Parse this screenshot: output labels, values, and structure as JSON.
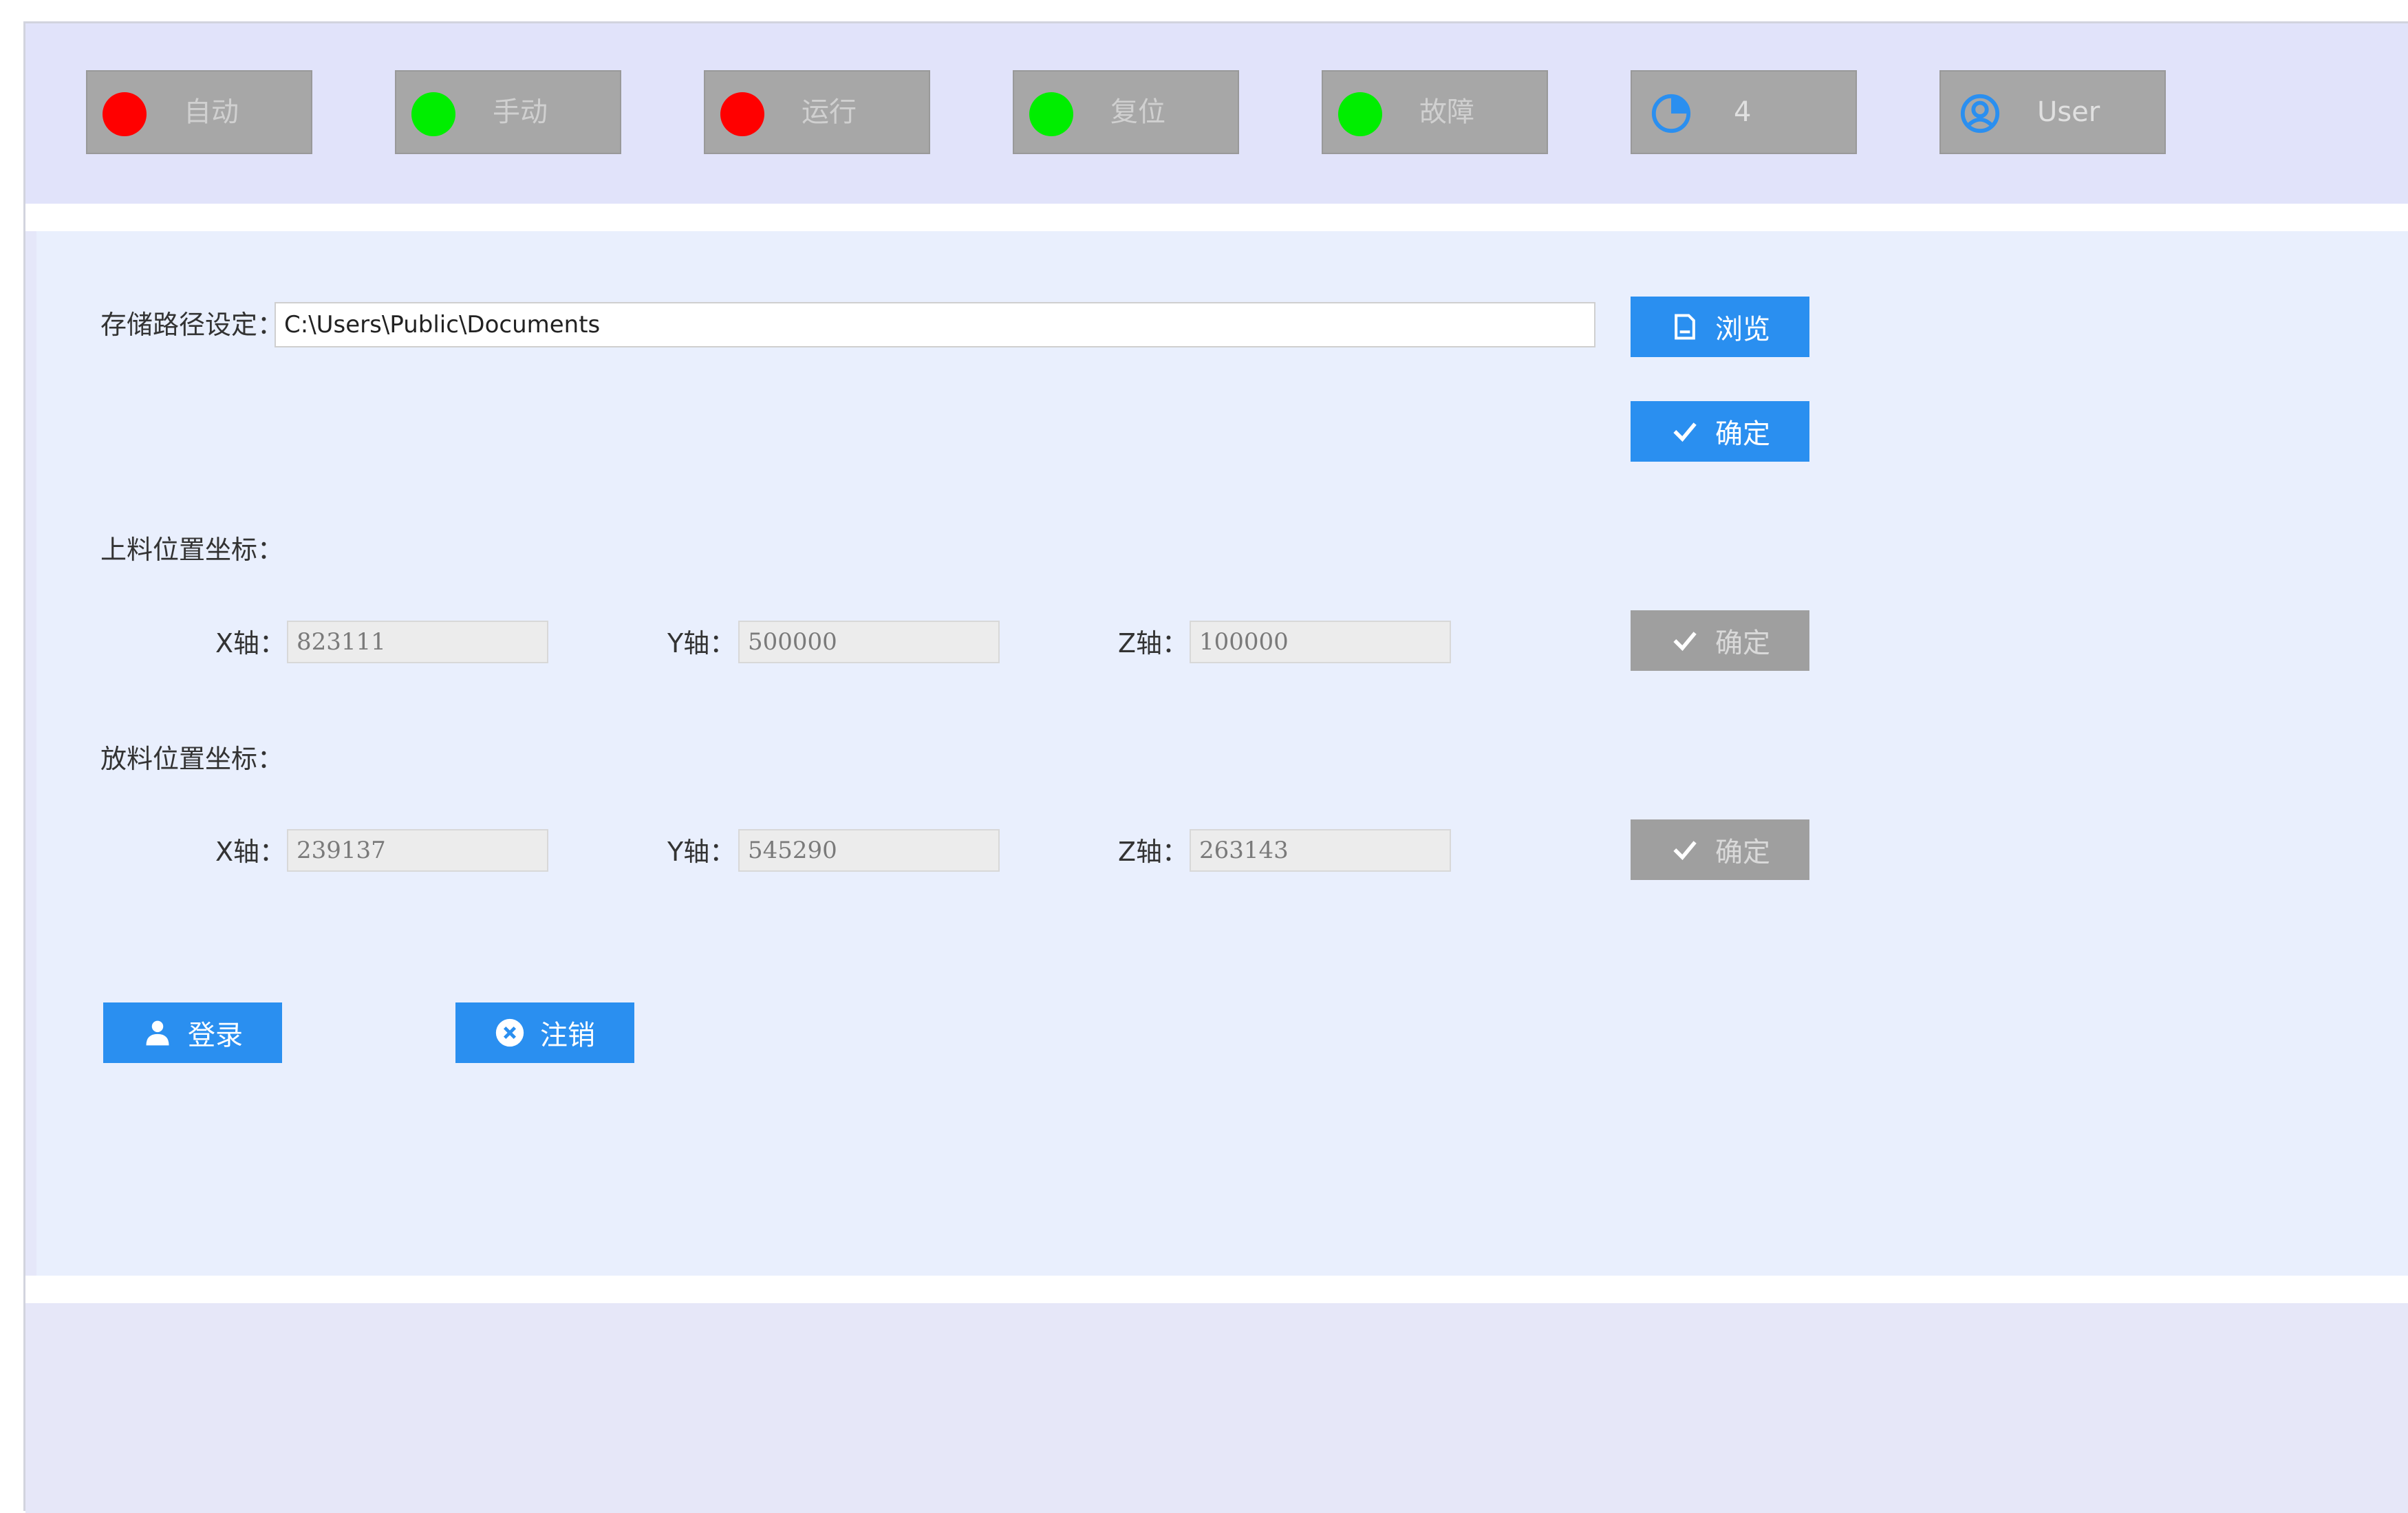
{
  "status_bar": [
    {
      "label": "自动",
      "color": "#ff0000"
    },
    {
      "label": "手动",
      "color": "#00ee00"
    },
    {
      "label": "运行",
      "color": "#ff0000"
    },
    {
      "label": "复位",
      "color": "#00ee00"
    },
    {
      "label": "故障",
      "color": "#00ee00"
    }
  ],
  "counter": {
    "value": "4",
    "icon": "pie-chart-icon"
  },
  "user": {
    "label": "User",
    "icon": "user-circle-icon"
  },
  "storage": {
    "label": "存储路径设定：",
    "path": "C:\\Users\\Public\\Documents",
    "browse_label": "浏览",
    "browse_icon": "document-icon",
    "confirm_label": "确定",
    "confirm_icon": "check-icon"
  },
  "load_position": {
    "label": "上料位置坐标：",
    "x_label": "X轴：",
    "x_value": "823111",
    "y_label": "Y轴：",
    "y_value": "500000",
    "z_label": "Z轴：",
    "z_value": "100000",
    "confirm_label": "确定"
  },
  "unload_position": {
    "label": "放料位置坐标：",
    "x_label": "X轴：",
    "x_value": "239137",
    "y_label": "Y轴：",
    "y_value": "545290",
    "z_label": "Z轴：",
    "z_value": "263143",
    "confirm_label": "确定"
  },
  "auth": {
    "login_label": "登录",
    "login_icon": "person-icon",
    "logout_label": "注销",
    "logout_icon": "close-circle-icon"
  },
  "colors": {
    "accent": "#2a8ff0",
    "disabled": "#9f9f9f",
    "status_red": "#ff0000",
    "status_green": "#00ee00"
  }
}
